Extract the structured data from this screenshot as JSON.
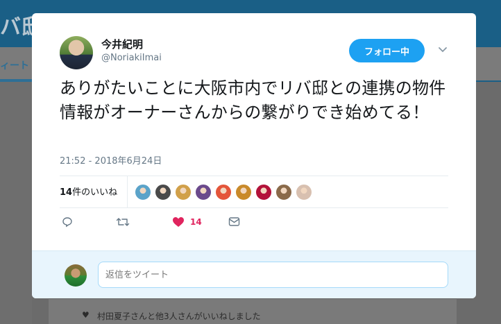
{
  "background": {
    "header_title": "バ邸",
    "nav_tab": "ィート",
    "activity_text": "村田夏子さんと他3人さんがいいねしました"
  },
  "tweet": {
    "author_name": "今井紀明",
    "author_handle": "@NoriakiImai",
    "follow_label": "フォロー中",
    "text": "ありがたいことに大阪市内でリバ邸との連携の物件情報がオーナーさんからの繋がりでき始めてる！",
    "timestamp": "21:52 - 2018年6月24日",
    "likes_count": "14",
    "likes_suffix": "件のいいね",
    "like_action_count": "14"
  },
  "reply": {
    "placeholder": "返信をツイート"
  },
  "icons": {
    "caret": "chevron-down-icon",
    "reply": "reply-icon",
    "retweet": "retweet-icon",
    "like": "heart-icon",
    "dm": "direct-message-icon"
  },
  "colors": {
    "accent": "#1da1f2",
    "like": "#e0245e",
    "text": "#14171a",
    "muted": "#657786"
  },
  "likers": [
    {
      "name": "liker-avatar-1",
      "color": "#5ba3c9"
    },
    {
      "name": "liker-avatar-2",
      "color": "#4a4a4a"
    },
    {
      "name": "liker-avatar-3",
      "color": "#d1a04a"
    },
    {
      "name": "liker-avatar-4",
      "color": "#6b4a8c"
    },
    {
      "name": "liker-avatar-5",
      "color": "#e4553a"
    },
    {
      "name": "liker-avatar-6",
      "color": "#c98a2a"
    },
    {
      "name": "liker-avatar-7",
      "color": "#b3123a"
    },
    {
      "name": "liker-avatar-8",
      "color": "#8a6a4a"
    },
    {
      "name": "liker-avatar-9",
      "color": "#d8c0b0"
    }
  ]
}
